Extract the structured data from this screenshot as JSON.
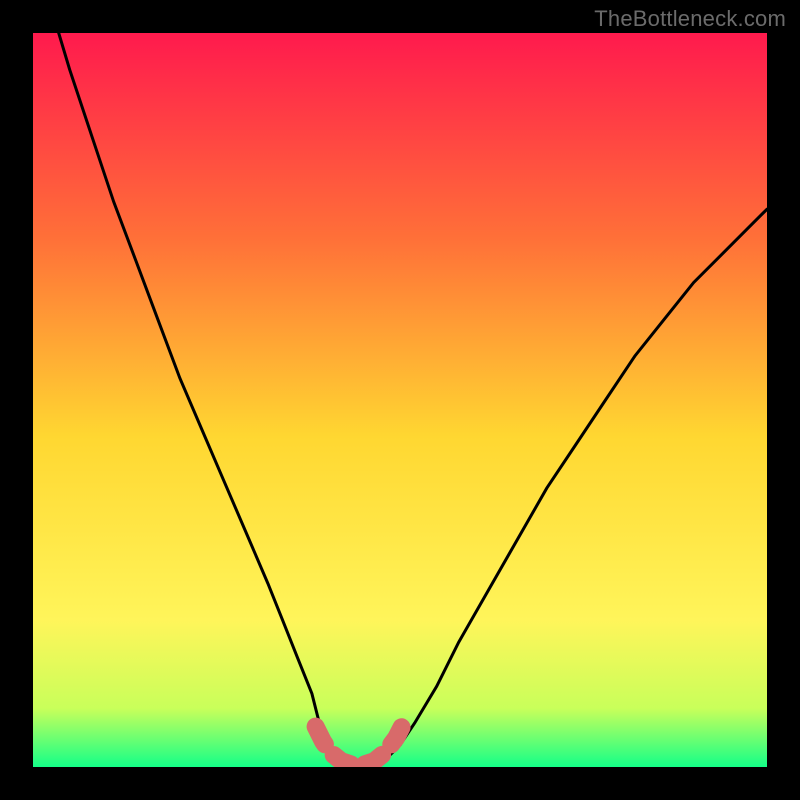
{
  "watermark": "TheBottleneck.com",
  "colors": {
    "frame": "#000000",
    "gradient_top": "#ff1a4d",
    "gradient_upper_mid": "#ff7038",
    "gradient_mid": "#ffd731",
    "gradient_lower": "#fff55a",
    "gradient_near_bottom": "#c9ff5a",
    "gradient_bottom": "#14ff88",
    "curve_stroke": "#000000",
    "marker_fill": "#d86a6a"
  },
  "chart_data": {
    "type": "line",
    "title": "",
    "xlabel": "",
    "ylabel": "",
    "xlim": [
      0,
      100
    ],
    "ylim": [
      0,
      100
    ],
    "x": [
      0,
      2,
      5,
      8,
      11,
      14,
      17,
      20,
      23,
      26,
      29,
      32,
      34,
      36,
      38,
      39,
      40,
      42,
      44,
      46,
      48,
      50,
      52,
      55,
      58,
      62,
      66,
      70,
      74,
      78,
      82,
      86,
      90,
      94,
      98,
      100
    ],
    "values": [
      113,
      105,
      95,
      86,
      77,
      69,
      61,
      53,
      46,
      39,
      32,
      25,
      20,
      15,
      10,
      6,
      3,
      1,
      0,
      0,
      1,
      3,
      6,
      11,
      17,
      24,
      31,
      38,
      44,
      50,
      56,
      61,
      66,
      70,
      74,
      76
    ],
    "markers": {
      "x": [
        38.5,
        39.5,
        40.5,
        42,
        43.5,
        45,
        46.5,
        48,
        49.5,
        50.5
      ],
      "y": [
        5.5,
        3.5,
        2,
        0.8,
        0.3,
        0.3,
        0.8,
        2,
        4,
        6
      ]
    }
  }
}
